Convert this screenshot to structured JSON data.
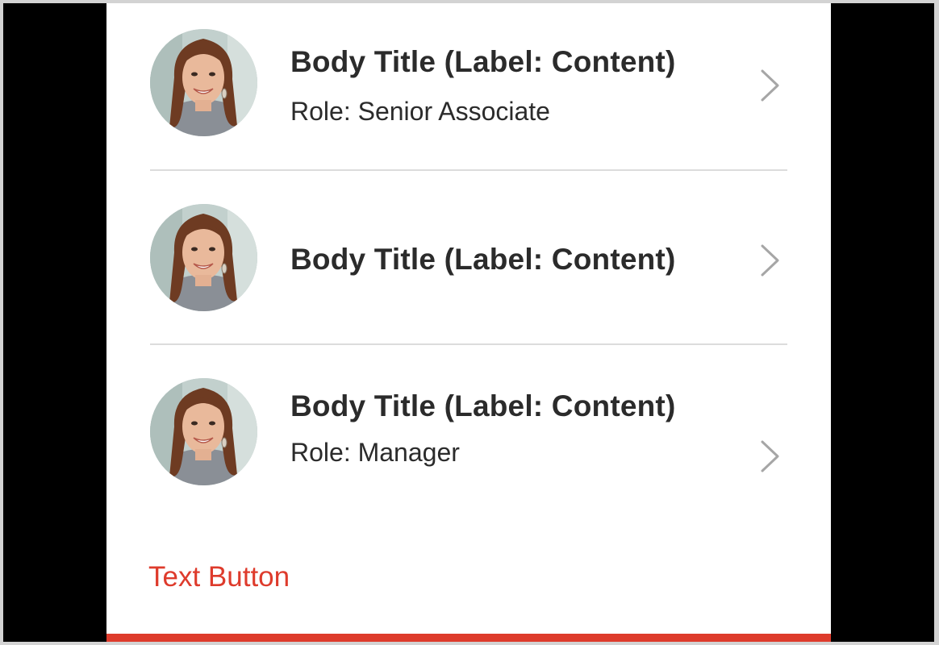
{
  "list": {
    "items": [
      {
        "title": "Body Title (Label: Content)",
        "subtitle": "Role: Senior Associate",
        "avatar_icon": "person-photo",
        "chevron_icon": "chevron-right-icon"
      },
      {
        "title": "Body Title (Label: Content)",
        "avatar_icon": "person-photo",
        "chevron_icon": "chevron-right-icon"
      },
      {
        "title": "Body Title (Label: Content)",
        "subtitle": "Role: Manager",
        "avatar_icon": "person-photo",
        "chevron_icon": "chevron-right-icon"
      }
    ]
  },
  "footer": {
    "text_button_label": "Text Button"
  },
  "colors": {
    "accent": "#de3b2c",
    "title_text": "#2b2b2b",
    "divider": "#dcdcdc",
    "chevron": "#a6a6a6",
    "frame": "#000000",
    "card_background": "#ffffff"
  }
}
